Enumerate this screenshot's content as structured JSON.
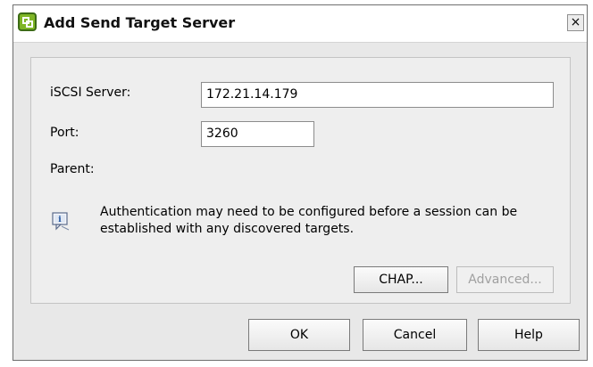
{
  "window": {
    "title": "Add Send Target Server",
    "close_glyph": "×"
  },
  "form": {
    "iscsi_server_label": "iSCSI Server:",
    "iscsi_server_value": "172.21.14.179",
    "port_label": "Port:",
    "port_value": "3260",
    "parent_label": "Parent:"
  },
  "note": {
    "icon": "info-icon",
    "text": "Authentication may need to be configured before a session can be established with any discovered targets."
  },
  "buttons": {
    "chap": "CHAP...",
    "advanced": "Advanced...",
    "ok": "OK",
    "cancel": "Cancel",
    "help": "Help"
  },
  "colors": {
    "brand_green": "#7fb526",
    "dialog_background": "#e8e8e8"
  }
}
